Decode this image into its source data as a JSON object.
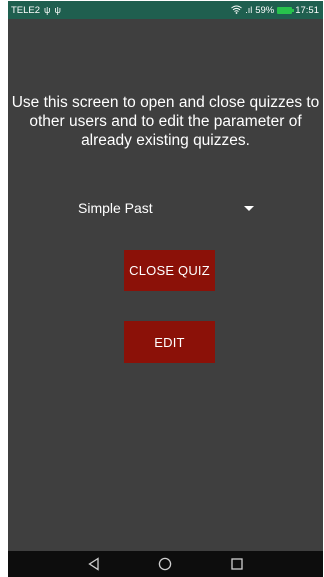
{
  "status_bar": {
    "carrier": "TELE2",
    "usb_icon_1": "usb-icon",
    "usb_icon_2": "usb-icon",
    "signal_text": ".ıl",
    "battery_percent": "59%",
    "time": "17:51"
  },
  "main": {
    "description": "Use this screen to open and close quizzes to other users and to edit the parameter of already existing quizzes.",
    "quiz_select": {
      "selected": "Simple Past"
    },
    "close_quiz_button": "CLOSE QUIZ",
    "edit_button": "EDIT"
  },
  "nav_bar": {
    "back_icon": "back-triangle-icon",
    "home_icon": "home-circle-icon",
    "recents_icon": "recents-square-icon"
  },
  "colors": {
    "status_bar": "#1f5f4f",
    "background": "#3f3f3f",
    "button": "#8b1108",
    "nav_bar": "#0d0d0d",
    "battery": "#27c24c"
  }
}
